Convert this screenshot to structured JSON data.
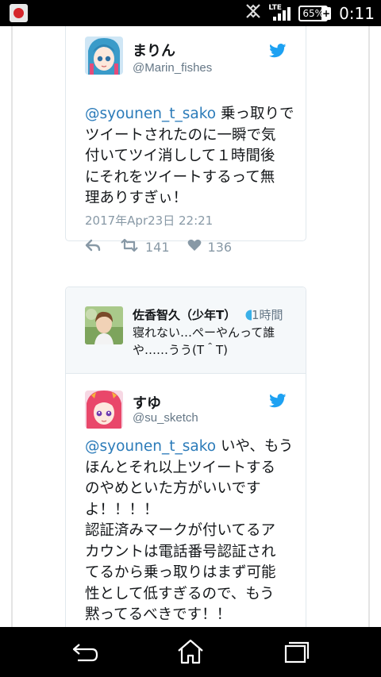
{
  "status_bar": {
    "app_icon": "app-notification-icon",
    "network": "LTE",
    "battery": "65%",
    "time": "0:11"
  },
  "tweet1": {
    "name": "まりん",
    "handle": "@Marin_fishes",
    "mention": "@syounen_t_sako",
    "text": " 乗っ取りで\nツイートされたのに一瞬で気\n付いてツイ消しして１時間後\nにそれをツイートするって無\n理ありすぎぃ！",
    "date": "2017年Apr23日 22:21",
    "retweets": "141",
    "likes": "136"
  },
  "quoted": {
    "name": "佐香智久（少年T）",
    "time": "1時間",
    "text": "寝れない…ぺーやんって誰\nや……うう(T＾T)"
  },
  "tweet2": {
    "name": "すゆ",
    "handle": "@su_sketch",
    "mention": "@syounen_t_sako",
    "text": " いや、もう\nほんとそれ以上ツイートする\nのやめといた方がいいです\nよ！！！！\n認証済みマークが付いてるア\nカウントは電話番号認証され\nてるから乗っ取りはまず可能\n性として低すぎるので、もう\n黙ってるべきです！！\n性欲は誰にでもありますか"
  },
  "colors": {
    "twitter_blue": "#1da1f2",
    "link": "#2b7bb9",
    "muted": "#8899a6"
  }
}
